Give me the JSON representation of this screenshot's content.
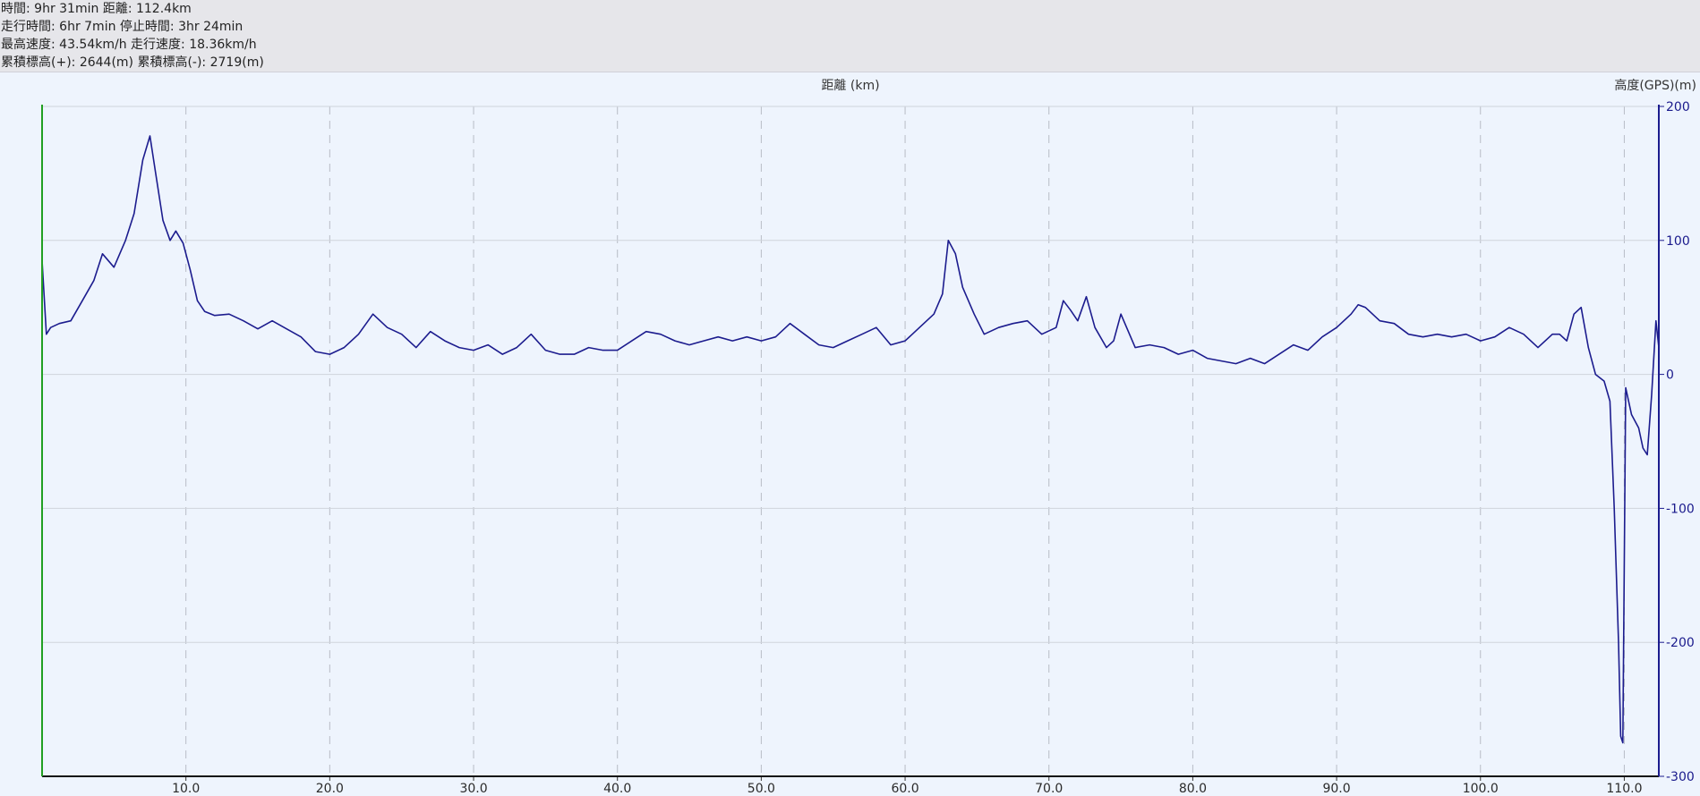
{
  "stats": {
    "line1": "時間: 9hr 31min 距離: 112.4km",
    "line2": "走行時間: 6hr 7min 停止時間: 3hr 24min",
    "line3": "最高速度: 43.54km/h 走行速度: 18.36km/h",
    "line4": "累積標高(+): 2644(m) 累積標高(-): 2719(m)"
  },
  "colors": {
    "series": "#1c1c8e",
    "left_axis": "#22a022",
    "right_axis": "#1c1c8e",
    "background": "#eef4fd",
    "header": "#e6e6ea"
  },
  "chart_data": {
    "type": "line",
    "xlabel": "距離 (km)",
    "ylabel": "高度(GPS)(m)",
    "xlim": [
      0,
      112.4
    ],
    "ylim": [
      -300,
      200
    ],
    "xticks": [
      "10.0",
      "20.0",
      "30.0",
      "40.0",
      "50.0",
      "60.0",
      "70.0",
      "80.0",
      "90.0",
      "100.0",
      "110.0"
    ],
    "yticks": [
      "200",
      "100",
      "0",
      "-100",
      "-200",
      "-300"
    ],
    "grid": true,
    "series": [
      {
        "x": [
          0,
          0.3,
          0.6,
          1.2,
          2.0,
          2.8,
          3.6,
          4.2,
          5.0,
          5.8,
          6.4,
          7.0,
          7.5,
          7.9,
          8.4,
          8.9,
          9.3,
          9.8,
          10.3,
          10.8,
          11.3,
          12.0,
          13.0,
          14.0,
          15.0,
          16.0,
          17.0,
          18.0,
          19.0,
          20.0,
          21.0,
          22.0,
          23.0,
          24.0,
          25.0,
          26.0,
          27.0,
          28.0,
          29.0,
          30.0,
          31.0,
          32.0,
          33.0,
          34.0,
          35.0,
          36.0,
          37.0,
          38.0,
          39.0,
          40.0,
          41.0,
          42.0,
          43.0,
          44.0,
          45.0,
          46.0,
          47.0,
          48.0,
          49.0,
          50.0,
          51.0,
          52.0,
          53.0,
          54.0,
          55.0,
          56.0,
          57.0,
          58.0,
          59.0,
          60.0,
          61.0,
          62.0,
          62.6,
          63.0,
          63.5,
          64.0,
          64.8,
          65.5,
          66.5,
          67.5,
          68.5,
          69.5,
          70.5,
          71.0,
          71.5,
          72.0,
          72.6,
          73.2,
          74.0,
          74.5,
          75.0,
          76.0,
          77.0,
          78.0,
          79.0,
          80.0,
          81.0,
          82.0,
          83.0,
          84.0,
          85.0,
          86.0,
          87.0,
          88.0,
          89.0,
          90.0,
          91.0,
          91.5,
          92.0,
          93.0,
          94.0,
          95.0,
          96.0,
          97.0,
          98.0,
          99.0,
          100.0,
          101.0,
          102.0,
          103.0,
          104.0,
          105.0,
          105.5,
          106.0,
          106.5,
          107.0,
          107.5,
          108.0,
          108.6,
          109.0,
          109.3,
          109.6,
          109.75,
          109.9,
          110.1,
          110.5,
          111.0,
          111.3,
          111.6,
          111.9,
          112.2,
          112.4
        ],
        "y": [
          85,
          30,
          35,
          38,
          40,
          55,
          70,
          90,
          80,
          100,
          120,
          160,
          178,
          150,
          115,
          100,
          107,
          98,
          78,
          55,
          47,
          44,
          45,
          40,
          34,
          40,
          34,
          28,
          17,
          15,
          20,
          30,
          45,
          35,
          30,
          20,
          32,
          25,
          20,
          18,
          22,
          15,
          20,
          30,
          18,
          15,
          15,
          20,
          18,
          18,
          25,
          32,
          30,
          25,
          22,
          25,
          28,
          25,
          28,
          25,
          28,
          38,
          30,
          22,
          20,
          25,
          30,
          35,
          22,
          25,
          35,
          45,
          60,
          100,
          90,
          65,
          45,
          30,
          35,
          38,
          40,
          30,
          35,
          55,
          48,
          40,
          58,
          35,
          20,
          25,
          45,
          20,
          22,
          20,
          15,
          18,
          12,
          10,
          8,
          12,
          8,
          15,
          22,
          18,
          28,
          35,
          45,
          52,
          50,
          40,
          38,
          30,
          28,
          30,
          28,
          30,
          25,
          28,
          35,
          30,
          20,
          30,
          30,
          25,
          45,
          50,
          20,
          0,
          -5,
          -20,
          -100,
          -200,
          -270,
          -275,
          -10,
          -30,
          -40,
          -55,
          -60,
          -15,
          40,
          20
        ]
      }
    ]
  }
}
